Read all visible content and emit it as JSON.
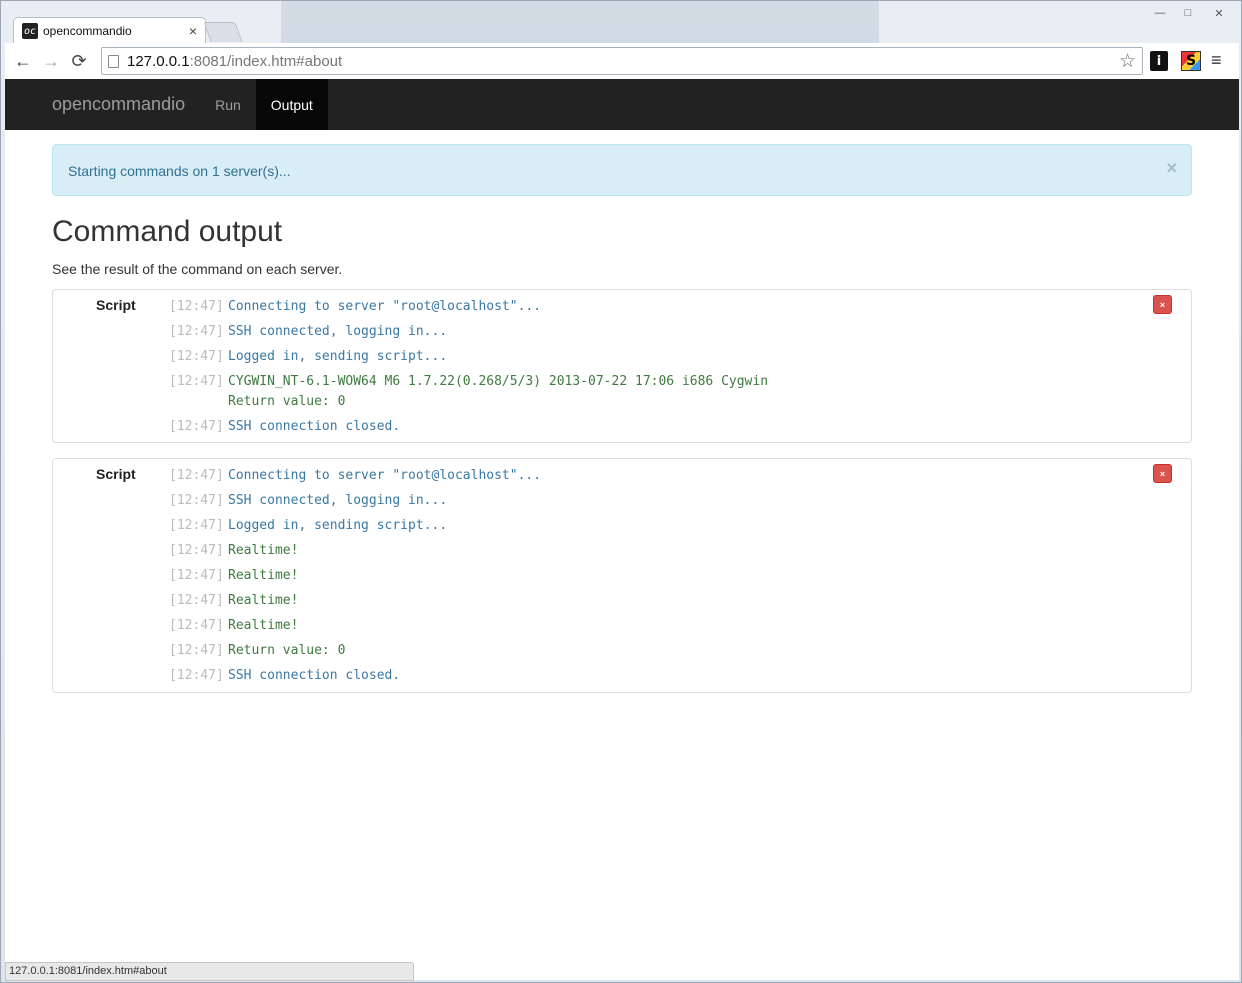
{
  "browser": {
    "tab_title": "opencommandio",
    "tab_close": "×",
    "favicon_text": "oc",
    "window_controls": [
      "—",
      "□",
      "✕"
    ],
    "nav": {
      "back": "←",
      "forward": "→",
      "reload": "⟳"
    },
    "url_host": "127.0.0.1",
    "url_rest": ":8081/index.htm#about",
    "bookmark_icon": "☆",
    "extensions": [
      "i",
      "S"
    ],
    "menu_icon": "≡",
    "status_url": "127.0.0.1:8081/index.htm#about"
  },
  "app": {
    "brand": "opencommandio",
    "nav": [
      {
        "label": "Run",
        "active": false
      },
      {
        "label": "Output",
        "active": true
      }
    ]
  },
  "alert": {
    "message": "Starting commands on 1 server(s)...",
    "close": "×"
  },
  "page": {
    "title": "Command output",
    "subtitle": "See the result of the command on each server."
  },
  "panels": [
    {
      "label": "Script",
      "remove": "×",
      "lines": [
        {
          "ts": "[12:47]",
          "msg": "Connecting to server \"root@localhost\"...",
          "kind": "info"
        },
        {
          "ts": "[12:47]",
          "msg": "SSH connected, logging in...",
          "kind": "info"
        },
        {
          "ts": "[12:47]",
          "msg": "Logged in, sending script...",
          "kind": "info"
        },
        {
          "ts": "[12:47]",
          "msg": "CYGWIN_NT-6.1-WOW64 M6 1.7.22(0.268/5/3) 2013-07-22 17:06 i686 Cygwin\nReturn value: 0",
          "kind": "out"
        },
        {
          "ts": "[12:47]",
          "msg": "SSH connection closed.",
          "kind": "info"
        }
      ]
    },
    {
      "label": "Script",
      "remove": "×",
      "lines": [
        {
          "ts": "[12:47]",
          "msg": "Connecting to server \"root@localhost\"...",
          "kind": "info"
        },
        {
          "ts": "[12:47]",
          "msg": "SSH connected, logging in...",
          "kind": "info"
        },
        {
          "ts": "[12:47]",
          "msg": "Logged in, sending script...",
          "kind": "info"
        },
        {
          "ts": "[12:47]",
          "msg": "Realtime!",
          "kind": "out"
        },
        {
          "ts": "[12:47]",
          "msg": "Realtime!",
          "kind": "out"
        },
        {
          "ts": "[12:47]",
          "msg": "Realtime!",
          "kind": "out"
        },
        {
          "ts": "[12:47]",
          "msg": "Realtime!",
          "kind": "out"
        },
        {
          "ts": "[12:47]",
          "msg": "Return value: 0",
          "kind": "out"
        },
        {
          "ts": "[12:47]",
          "msg": "SSH connection closed.",
          "kind": "info"
        }
      ]
    }
  ]
}
